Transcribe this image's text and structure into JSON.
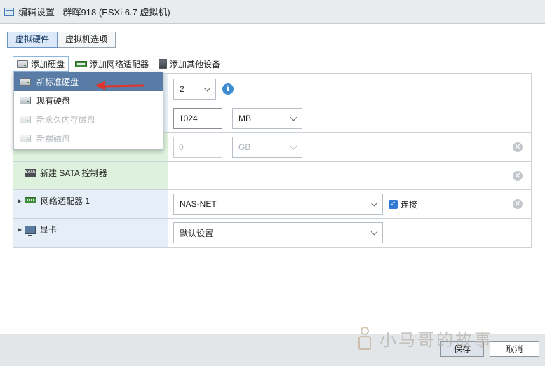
{
  "window": {
    "title": "编辑设置 - 群晖918 (ESXi 6.7 虚拟机)"
  },
  "tabs": [
    {
      "label": "虚拟硬件",
      "active": true
    },
    {
      "label": "虚拟机选项",
      "active": false
    }
  ],
  "toolbar": {
    "add_disk": "添加硬盘",
    "add_network": "添加网络适配器",
    "add_other": "添加其他设备"
  },
  "dropdown": {
    "items": [
      {
        "label": "新标准硬盘",
        "highlighted": true,
        "enabled": true
      },
      {
        "label": "现有硬盘",
        "highlighted": false,
        "enabled": true
      },
      {
        "label": "新永久内存磁盘",
        "highlighted": false,
        "enabled": false
      },
      {
        "label": "新裸磁盘",
        "highlighted": false,
        "enabled": false
      }
    ]
  },
  "rows": {
    "cpu": {
      "value": "2"
    },
    "memory": {
      "value": "1024",
      "unit": "MB"
    },
    "disk": {
      "value": "0",
      "unit": "GB"
    },
    "sata": {
      "label": "新建 SATA 控制器",
      "icon_text": "SATA"
    },
    "network": {
      "label": "网络适配器 1",
      "value": "NAS-NET",
      "connect_label": "连接",
      "connected": true
    },
    "display": {
      "label": "显卡",
      "value": "默认设置"
    }
  },
  "footer": {
    "save": "保存",
    "cancel": "取消"
  },
  "watermark": {
    "text": "小马哥的故事"
  },
  "colors": {
    "highlight": "#587ca6",
    "accent_blue": "#3f8bd2",
    "checkbox": "#2f7ad7",
    "arrow_red": "#e0352b",
    "row_green": "#ddf1dc",
    "row_blue": "#e6eff7"
  }
}
